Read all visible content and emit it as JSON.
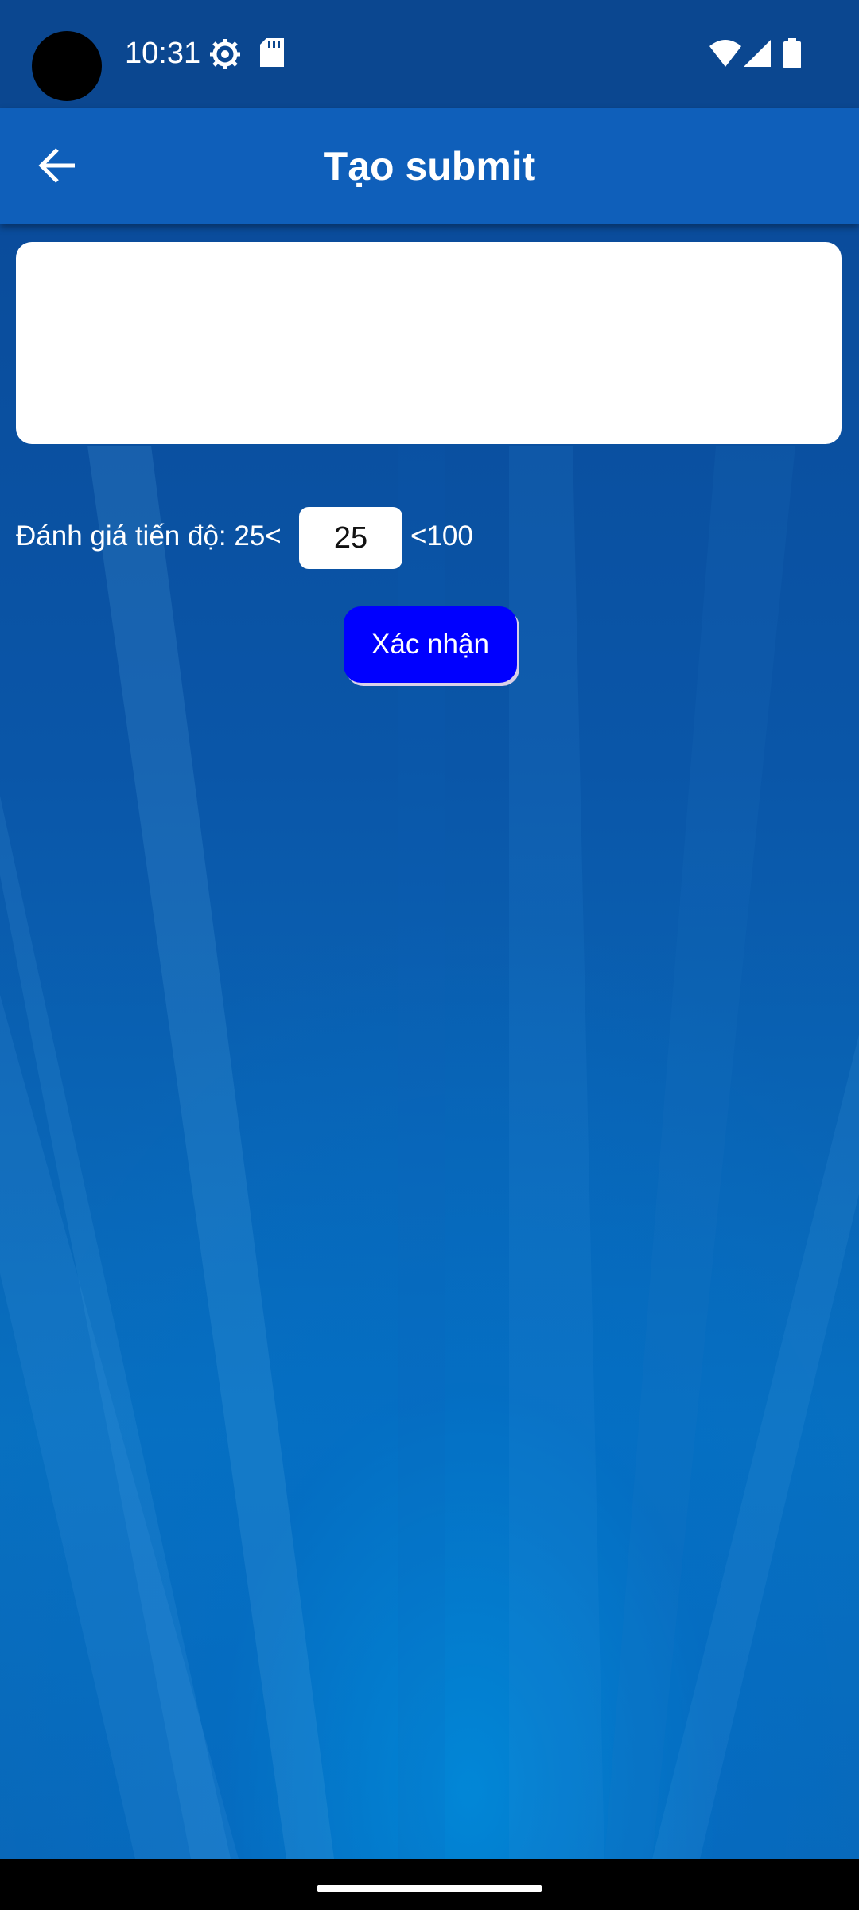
{
  "status_bar": {
    "time": "10:31",
    "icons": [
      "settings-gear-icon",
      "sd-card-icon",
      "wifi-icon",
      "cellular-signal-icon",
      "battery-icon"
    ]
  },
  "app_bar": {
    "title": "Tạo submit",
    "back_icon": "arrow-back-icon"
  },
  "form": {
    "text_area_value": "",
    "rating_label": "Đánh giá tiến độ: 25<",
    "rating_value": "25",
    "rating_max_label": "<100",
    "confirm_label": "Xác nhận"
  },
  "colors": {
    "status_bar": "#0b4790",
    "app_bar": "#0f5fba",
    "button": "#0000ff",
    "background": "#0a56a8"
  }
}
